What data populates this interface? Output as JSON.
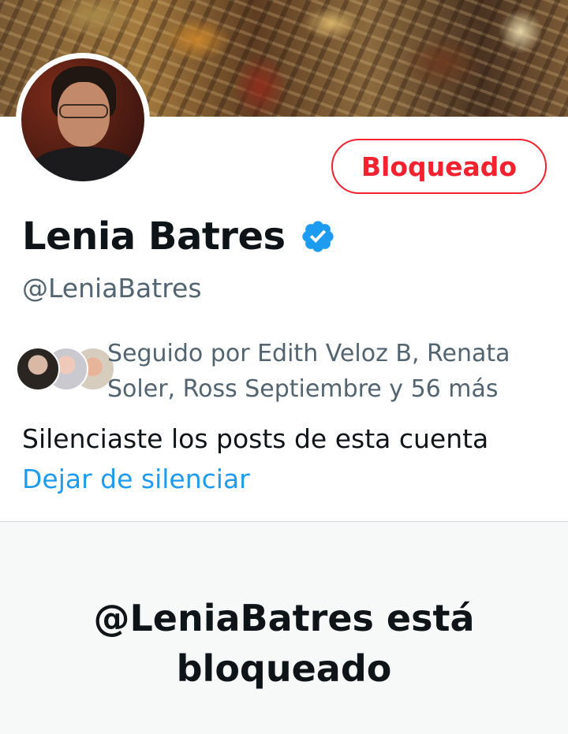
{
  "profile": {
    "name": "Lenia Batres",
    "handle": "@LeniaBatres",
    "verified_color": "#1d9bf0"
  },
  "actions": {
    "blocked_label": "Bloqueado"
  },
  "followers": {
    "text": "Seguido por Edith Veloz B, Renata Soler, Ross Septiembre y 56 más"
  },
  "mute": {
    "notice": "Silenciaste los posts de esta cuenta",
    "unmute_label": "Dejar de silenciar"
  },
  "blocked_panel": {
    "heading": "@LeniaBatres está bloqueado"
  },
  "colors": {
    "accent": "#1d9bf0",
    "danger": "#f4212e",
    "secondary_text": "#536471"
  }
}
